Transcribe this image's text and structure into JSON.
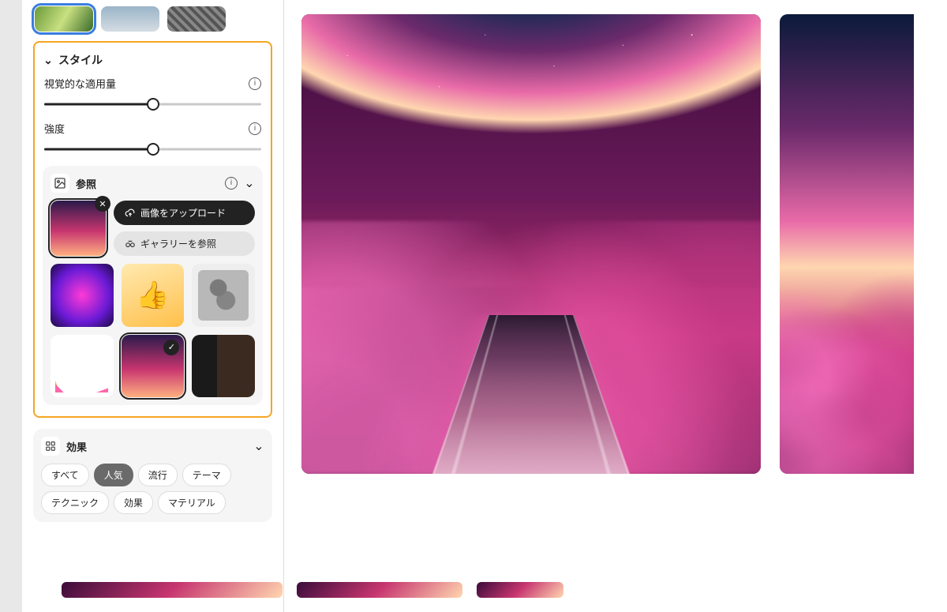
{
  "sidebar": {
    "style_section_title": "スタイル",
    "visual_amount_label": "視覚的な適用量",
    "visual_amount_pct": 50,
    "strength_label": "強度",
    "strength_pct": 50,
    "reference": {
      "title": "参照",
      "upload_label": "画像をアップロード",
      "browse_label": "ギャラリーを参照"
    },
    "effects": {
      "title": "効果",
      "chips": [
        "すべて",
        "人気",
        "流行",
        "テーマ",
        "テクニック",
        "効果",
        "マテリアル"
      ],
      "active_chip_index": 1
    }
  }
}
